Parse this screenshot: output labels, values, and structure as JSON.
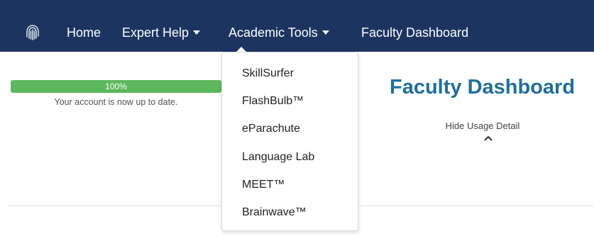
{
  "navbar": {
    "logo_icon": "fingerprint-icon",
    "items": [
      {
        "label": "Home"
      },
      {
        "label": "Expert Help",
        "has_caret": true
      },
      {
        "label": "Academic Tools",
        "has_caret": true
      },
      {
        "label": "Faculty Dashboard"
      }
    ],
    "background": "#1d3460"
  },
  "progress": {
    "value_percent": 100,
    "label": "100%",
    "caption": "Your account is now up to date.",
    "color": "#5cb85c"
  },
  "main": {
    "title": "Faculty Dashboard",
    "title_color": "#1f6f9f",
    "usage_toggle_label": "Hide Usage Detail",
    "usage_toggle_icon": "chevron-up-icon"
  },
  "dropdown": {
    "items": [
      {
        "label": "SkillSurfer"
      },
      {
        "label": "FlashBulb™"
      },
      {
        "label": "eParachute"
      },
      {
        "label": "Language Lab"
      },
      {
        "label": "MEET™"
      },
      {
        "label": "Brainwave™"
      }
    ]
  }
}
